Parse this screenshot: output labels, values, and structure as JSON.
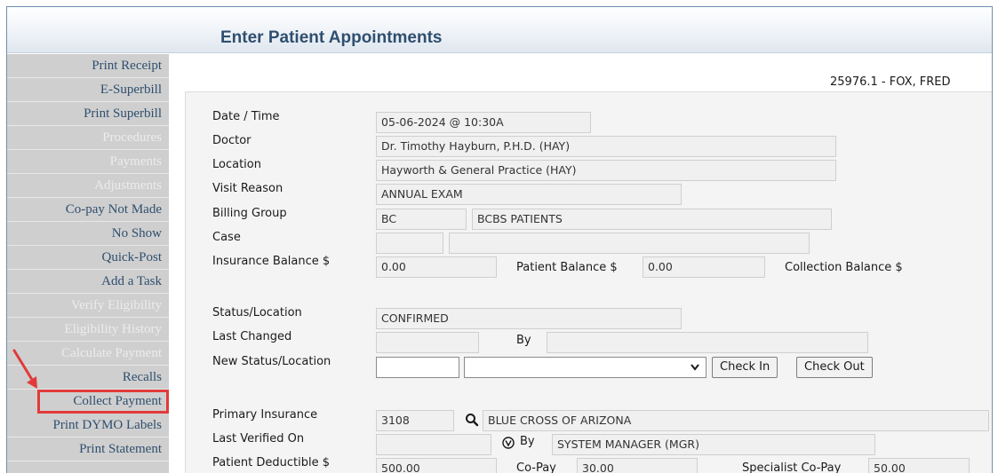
{
  "header": {
    "title": "Enter Patient Appointments"
  },
  "patient": {
    "id_name": "25976.1 - FOX, FRED"
  },
  "sidebar": {
    "items": [
      {
        "label": "Print Receipt",
        "enabled": true
      },
      {
        "label": "E-Superbill",
        "enabled": true
      },
      {
        "label": "Print Superbill",
        "enabled": true
      },
      {
        "label": "Procedures",
        "enabled": false
      },
      {
        "label": "Payments",
        "enabled": false
      },
      {
        "label": "Adjustments",
        "enabled": false
      },
      {
        "label": "Co-pay Not Made",
        "enabled": true
      },
      {
        "label": "No Show",
        "enabled": true
      },
      {
        "label": "Quick-Post",
        "enabled": true
      },
      {
        "label": "Add a Task",
        "enabled": true
      },
      {
        "label": "Verify Eligibility",
        "enabled": false
      },
      {
        "label": "Eligibility History",
        "enabled": false
      },
      {
        "label": "Calculate Payment",
        "enabled": false
      },
      {
        "label": "Recalls",
        "enabled": true
      },
      {
        "label": "Collect Payment",
        "enabled": true,
        "highlighted": true
      },
      {
        "label": "Print DYMO Labels",
        "enabled": true
      },
      {
        "label": "Print Statement",
        "enabled": true
      }
    ]
  },
  "form": {
    "date_time": {
      "label": "Date / Time",
      "value": "05-06-2024 @ 10:30A"
    },
    "doctor": {
      "label": "Doctor",
      "value": "Dr. Timothy Hayburn, P.H.D. (HAY)"
    },
    "location": {
      "label": "Location",
      "value": "Hayworth & General Practice (HAY)"
    },
    "visit_reason": {
      "label": "Visit Reason",
      "value": "ANNUAL EXAM"
    },
    "billing_group": {
      "label": "Billing Group",
      "code": "BC",
      "name": "BCBS PATIENTS"
    },
    "case": {
      "label": "Case",
      "code": "",
      "name": ""
    },
    "insurance_balance": {
      "label": "Insurance Balance $",
      "value": "0.00"
    },
    "patient_balance": {
      "label": "Patient Balance $",
      "value": "0.00"
    },
    "collection_balance": {
      "label": "Collection Balance $"
    },
    "status_location": {
      "label": "Status/Location",
      "value": "CONFIRMED"
    },
    "last_changed": {
      "label": "Last Changed",
      "value": "",
      "by_label": "By",
      "by_value": ""
    },
    "new_status": {
      "label": "New Status/Location",
      "code": "",
      "selected": "",
      "check_in": "Check In",
      "check_out": "Check Out"
    },
    "primary_insurance": {
      "label": "Primary Insurance",
      "code": "3108",
      "name": "BLUE CROSS OF ARIZONA"
    },
    "last_verified": {
      "label": "Last Verified On",
      "value": "",
      "by_label": "By",
      "by_value": "SYSTEM MANAGER (MGR)"
    },
    "patient_deductible": {
      "label": "Patient Deductible $",
      "value": "500.00"
    },
    "copay": {
      "label": "Co-Pay",
      "value": "30.00"
    },
    "specialist_copay": {
      "label": "Specialist Co-Pay",
      "value": "50.00"
    }
  },
  "annotation": {
    "arrow_color": "#e23a3a"
  }
}
